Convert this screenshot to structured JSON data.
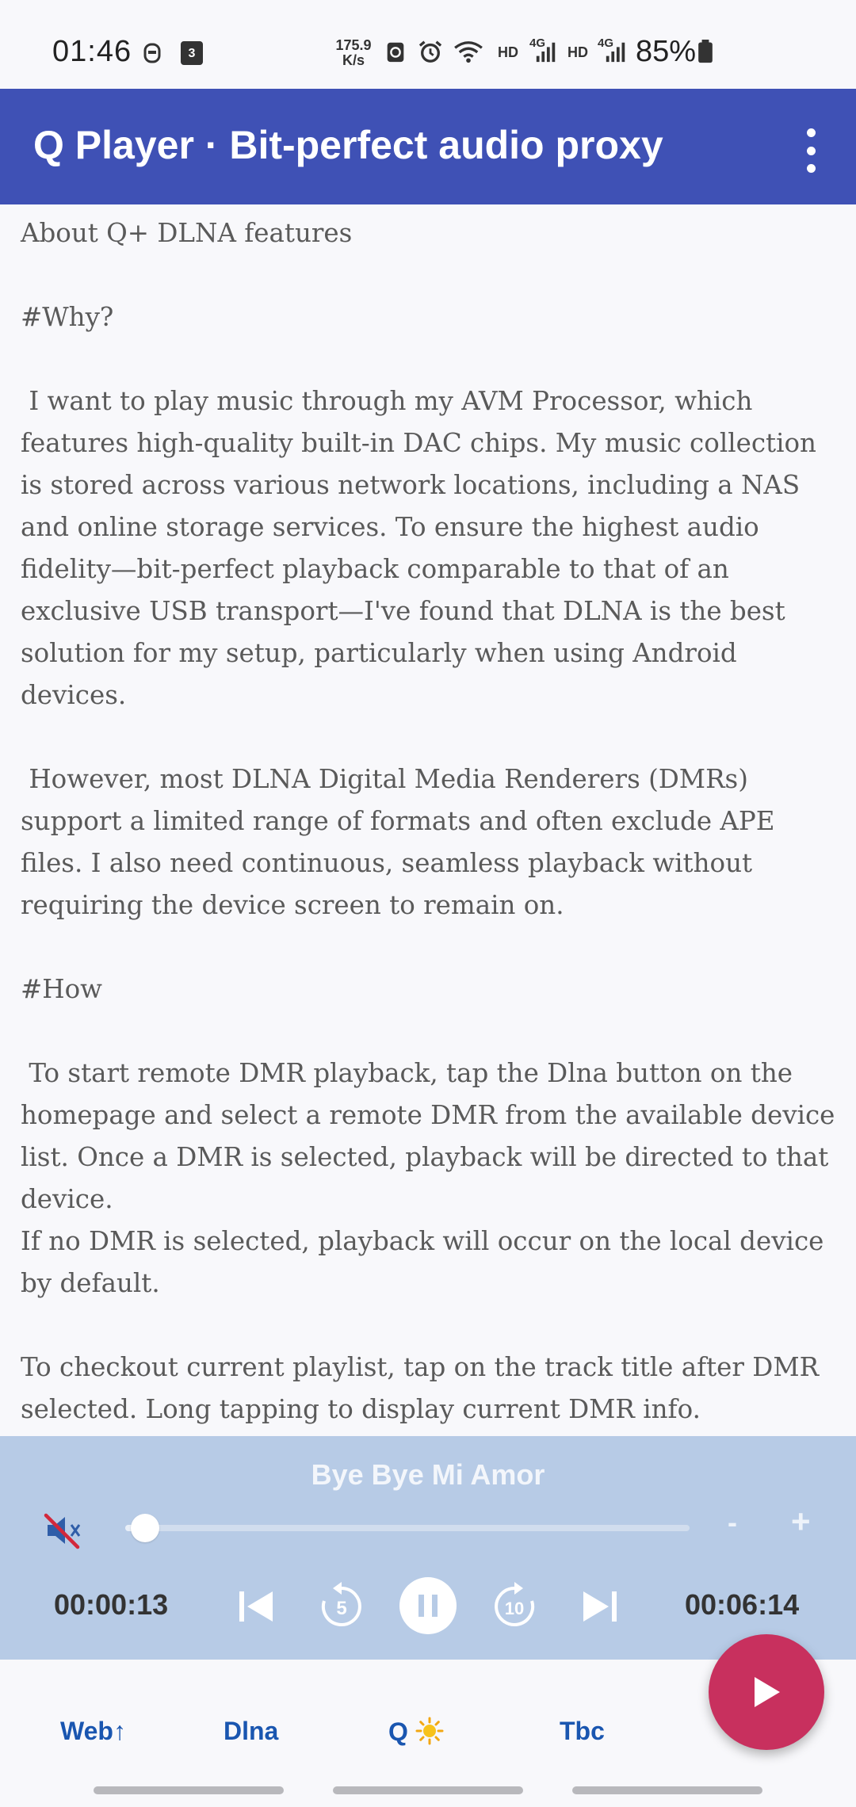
{
  "status_bar": {
    "time": "01:46",
    "notification_count": "3",
    "net_speed_value": "175.9",
    "net_speed_unit": "K/s",
    "network_label_1": "HD",
    "network_type_1": "4G",
    "network_label_2": "HD",
    "network_type_2": "4G",
    "battery": "85%"
  },
  "app_bar": {
    "title": "Q Player · Bit-perfect audio proxy",
    "color": "#3f51b5"
  },
  "content": {
    "heading": "About Q+ DLNA features",
    "why_heading": "#Why?",
    "why_p1": " I want to play music through my AVM Processor, which features high-quality built-in DAC chips. My music collection is stored across various network locations, including a NAS and online storage services. To ensure the highest audio fidelity—bit-perfect playback comparable to that of an exclusive USB transport—I've found that DLNA is the best solution for my setup, particularly when using Android devices.",
    "why_p2": " However, most DLNA Digital Media Renderers (DMRs) support a limited range of formats and often exclude APE files. I also need continuous, seamless playback without requiring the device screen to remain on.",
    "how_heading": "#How",
    "how_p1": " To start remote DMR playback, tap the Dlna button on the homepage and select a remote DMR from the available device list. Once a DMR is selected, playback will be directed to that device.",
    "how_p2": "If no DMR is selected, playback will occur on the local device by default.",
    "how_p3": "To checkout current playlist, tap on the track title after DMR selected. Long tapping to display current DMR info."
  },
  "player": {
    "track_title": "Bye Bye Mi Amor",
    "elapsed": "00:00:13",
    "total": "00:06:14",
    "progress_fraction": 0.035,
    "volume_down_label": "-",
    "volume_up_label": "+",
    "rewind_label": "5",
    "forward_label": "10",
    "muted": true,
    "panel_color": "#b7cbe6"
  },
  "bottom_nav": {
    "web_label": "Web↑",
    "dlna_label": "Dlna",
    "q_label": "Q",
    "tbc_label": "Tbc",
    "q_icon": "sun-emoji"
  },
  "fab": {
    "icon": "play-icon",
    "color": "#c8305e"
  }
}
